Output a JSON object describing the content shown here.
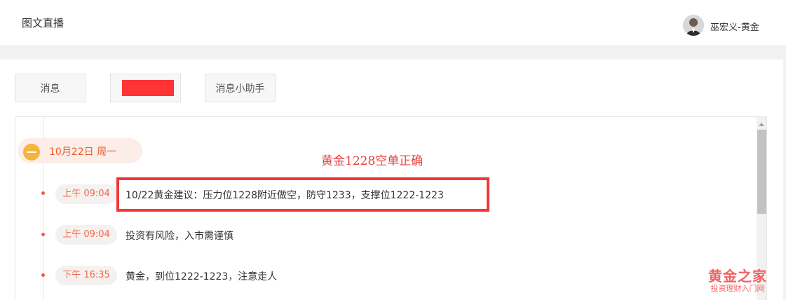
{
  "header": {
    "title": "图文直播",
    "user_name": "巫宏义-黄金"
  },
  "tabs": [
    {
      "label": "消息"
    },
    {
      "label": ""
    },
    {
      "label": "消息小助手"
    }
  ],
  "feed": {
    "date": "10月22日 周一",
    "date_icon": "—",
    "note": "黄金1228空单正确",
    "messages": [
      {
        "time": "上午 09:04",
        "text": "10/22黄金建议：压力位1228附近做空，防守1233，支撑位1222-1223"
      },
      {
        "time": "上午 09:04",
        "text": "投资有风险，入市需谨慎"
      },
      {
        "time": "下午 16:35",
        "text": "黄金，到位1222-1223，注意走人"
      }
    ]
  },
  "watermark": {
    "main": "黄金之家",
    "sub": "投资理财入门网"
  },
  "colors": {
    "accent": "#f06a4e",
    "highlight_border": "#f03838",
    "date_icon": "#f5b43b"
  }
}
